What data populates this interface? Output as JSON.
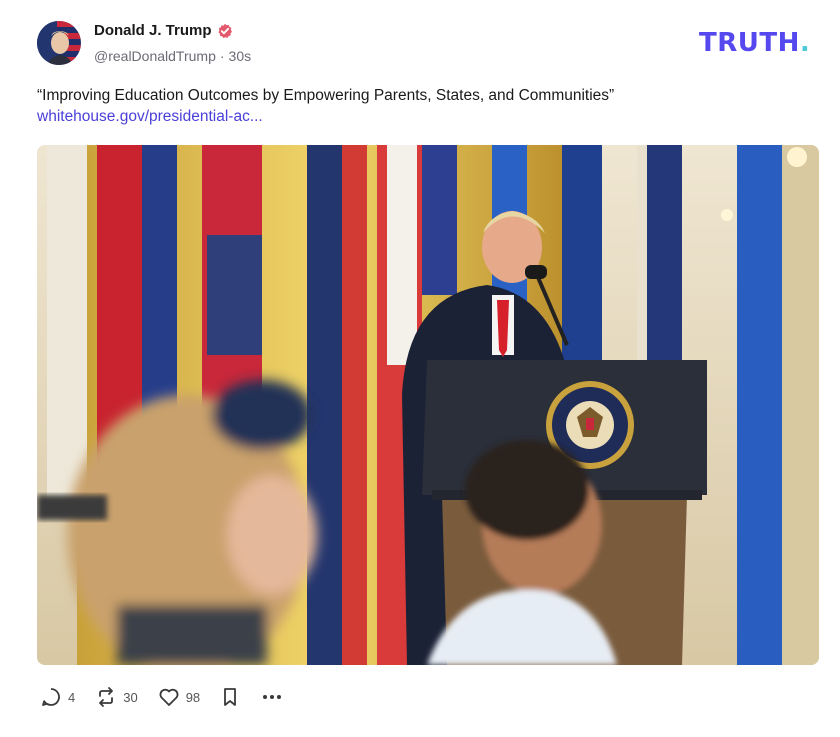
{
  "post": {
    "author": {
      "display_name": "Donald J. Trump",
      "handle": "@realDonaldTrump",
      "separator": "·",
      "time_ago": "30s",
      "verified_badge_icon": "verified-badge-icon",
      "avatar_icon": "avatar-flag-portrait"
    },
    "brand": {
      "logo_text": "TRUTH",
      "logo_dot": ".",
      "logo_color": "#5448ee",
      "logo_dot_color": "#4ec9d6"
    },
    "text": "“Improving Education Outcomes by Empowering Parents, States, and Communities”",
    "link_text": "whitehouse.gov/presidential-ac...",
    "link_color": "#4a3fd8",
    "media": {
      "seal_icon": "presidential-seal-icon"
    },
    "actions": {
      "reply_count": "4",
      "retruth_count": "30",
      "like_count": "98",
      "reply_icon": "reply-icon",
      "retruth_icon": "retruth-icon",
      "like_icon": "heart-icon",
      "bookmark_icon": "bookmark-icon",
      "more_icon": "more-icon"
    }
  }
}
